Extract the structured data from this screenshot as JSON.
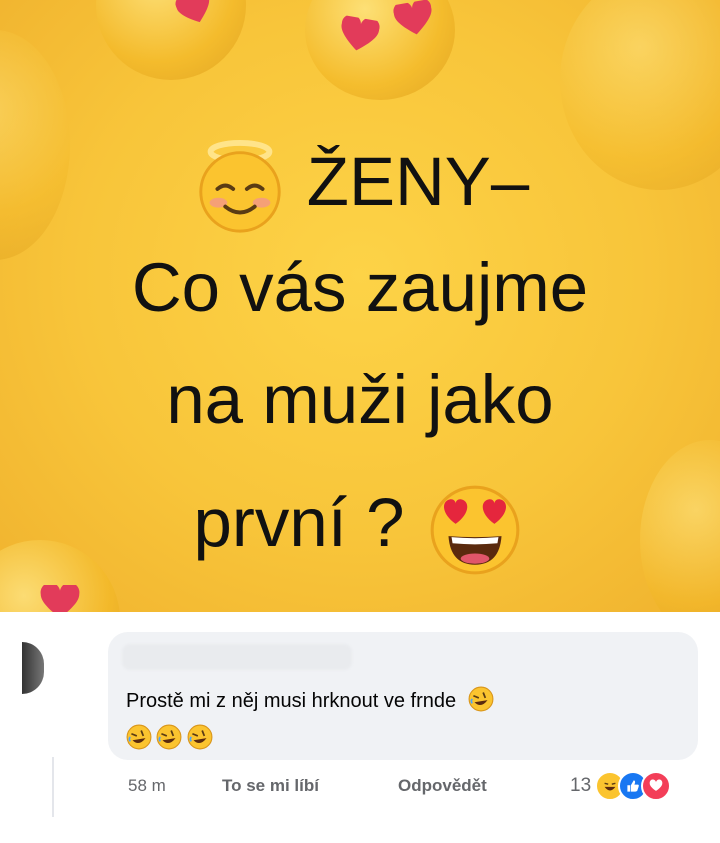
{
  "post": {
    "line1_text": "ŽENY–",
    "line2_text": "Co vás zaujme",
    "line3_text": "na muži jako",
    "line4_text": "první ?",
    "emojis": {
      "line1": "smiling-face-with-halo",
      "line4": "heart-eyes"
    }
  },
  "comment": {
    "text": "Prostě mi z něj musi hrknout ve frnde",
    "emoji_name": "rolling-on-floor-laughing"
  },
  "actions": {
    "time": "58 m",
    "like": "To se mi líbí",
    "reply": "Odpovědět"
  },
  "reactions": {
    "count": "13",
    "types": [
      "haha",
      "like",
      "love"
    ]
  },
  "colors": {
    "background": "#f8c53a",
    "bubble": "#f0f2f5",
    "like": "#1877f2",
    "love": "#f33e58"
  }
}
